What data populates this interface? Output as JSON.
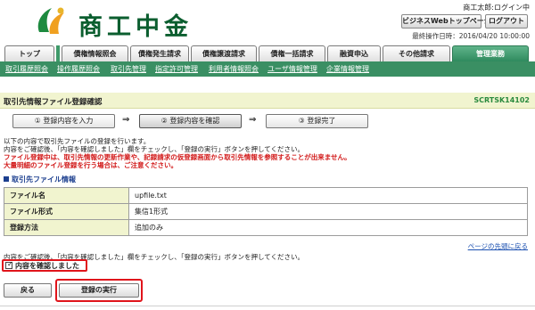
{
  "header": {
    "logo_text": "商工中金",
    "user_name": "商工太郎:ログイン中",
    "top_page_button": "ビジネスWebトップページへ",
    "logout_button": "ログアウト",
    "last_operation": "最終操作日時：2016/04/20 10:00:00"
  },
  "tabs": [
    {
      "label": "トップ"
    },
    {
      "label": "債権情報照会"
    },
    {
      "label": "債権発生請求"
    },
    {
      "label": "債権譲渡請求"
    },
    {
      "label": "債権一括請求"
    },
    {
      "label": "融資申込"
    },
    {
      "label": "その他請求"
    },
    {
      "label": "管理業務"
    }
  ],
  "subnav": [
    {
      "label": "取引履歴照会"
    },
    {
      "label": "操作履歴照会"
    },
    {
      "label": "取引先管理"
    },
    {
      "label": "指定許可管理"
    },
    {
      "label": "利用者情報照会"
    },
    {
      "label": "ユーザ情報管理"
    },
    {
      "label": "企業情報管理"
    }
  ],
  "page": {
    "title": "取引先情報ファイル登録確認",
    "screen_id": "SCRTSK14102"
  },
  "steps": [
    {
      "label": "① 登録内容を入力"
    },
    {
      "label": "② 登録内容を確認"
    },
    {
      "label": "③ 登録完了"
    }
  ],
  "step_arrow": "⇒",
  "messages": {
    "line1": "以下の内容で取引先ファイルの登録を行います。",
    "line2": "内容をご確認後、「内容を確認しました」欄をチェックし、「登録の実行」ボタンを押してください。",
    "warn1": "ファイル登録中は、取引先情報の更新作業や、記録請求の仮登録画面から取引先情報を参照することが出来ません。",
    "warn2": "大量明細のファイル登録を行う場合は、ご注意ください。"
  },
  "section": {
    "title": "取引先ファイル情報"
  },
  "info_rows": [
    {
      "key": "ファイル名",
      "value": "upfile.txt"
    },
    {
      "key": "ファイル形式",
      "value": "集信1形式"
    },
    {
      "key": "登録方法",
      "value": "追加のみ"
    }
  ],
  "page_top_link": "ページの先頭に戻る",
  "confirm": {
    "help": "内容をご確認後、「内容を確認しました」欄をチェックし、「登録の実行」ボタンを押してください。",
    "label": "内容を確認しました",
    "checked": true
  },
  "buttons": {
    "back": "戻る",
    "execute": "登録の実行"
  },
  "colors": {
    "brand_green": "#0b5e2f",
    "subnav_green": "#3a8f63",
    "highlight_red": "#e0141b",
    "warning_red": "#d21a1a"
  }
}
